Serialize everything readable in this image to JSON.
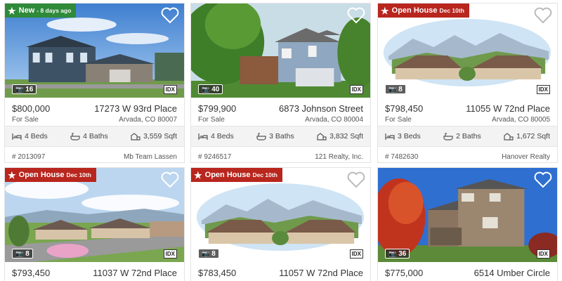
{
  "listings": [
    {
      "badge": {
        "type": "new",
        "label": "New",
        "date": "- 8 days ago"
      },
      "photo_count": "16",
      "idx": "IDX",
      "price": "$800,000",
      "status": "For Sale",
      "street": "17273 W 93rd Place",
      "city": "Arvada, CO 80007",
      "beds": "4 Beds",
      "baths": "4 Baths",
      "sqft": "3,559 Sqft",
      "mls": "# 2013097",
      "agent": "Mb Team Lassen"
    },
    {
      "badge": null,
      "photo_count": "40",
      "idx": "IDX",
      "price": "$799,900",
      "status": "For Sale",
      "street": "6873 Johnson Street",
      "city": "Arvada, CO 80004",
      "beds": "4 Beds",
      "baths": "3 Baths",
      "sqft": "3,832 Sqft",
      "mls": "# 9246517",
      "agent": "121 Realty, Inc."
    },
    {
      "badge": {
        "type": "open",
        "label": "Open House",
        "date": "Dec 10th"
      },
      "photo_count": "8",
      "idx": "IDX",
      "price": "$798,450",
      "status": "For Sale",
      "street": "11055 W 72nd Place",
      "city": "Arvada, CO 80005",
      "beds": "3 Beds",
      "baths": "2 Baths",
      "sqft": "1,672 Sqft",
      "mls": "# 7482630",
      "agent": "Hanover Realty"
    },
    {
      "badge": {
        "type": "open",
        "label": "Open House",
        "date": "Dec 10th"
      },
      "photo_count": "8",
      "idx": "IDX",
      "price": "$793,450",
      "status": "",
      "street": "11037 W 72nd Place",
      "city": "",
      "beds": "",
      "baths": "",
      "sqft": "",
      "mls": "",
      "agent": ""
    },
    {
      "badge": {
        "type": "open",
        "label": "Open House",
        "date": "Dec 10th"
      },
      "photo_count": "8",
      "idx": "IDX",
      "price": "$783,450",
      "status": "",
      "street": "11057 W 72nd Place",
      "city": "",
      "beds": "",
      "baths": "",
      "sqft": "",
      "mls": "",
      "agent": ""
    },
    {
      "badge": null,
      "photo_count": "36",
      "idx": "IDX",
      "price": "$775,000",
      "status": "",
      "street": "6514 Umber Circle",
      "city": "",
      "beds": "",
      "baths": "",
      "sqft": "",
      "mls": "",
      "agent": ""
    }
  ],
  "icons": {
    "favorite": "heart-icon",
    "photos": "camera-icon",
    "beds": "bed-icon",
    "baths": "bathtub-icon",
    "sqft": "area-icon",
    "badge": "star-icon"
  },
  "colors": {
    "new_badge": "#2f8a3a",
    "open_house_badge": "#b8261e",
    "feature_bar": "#f3f3f3"
  }
}
